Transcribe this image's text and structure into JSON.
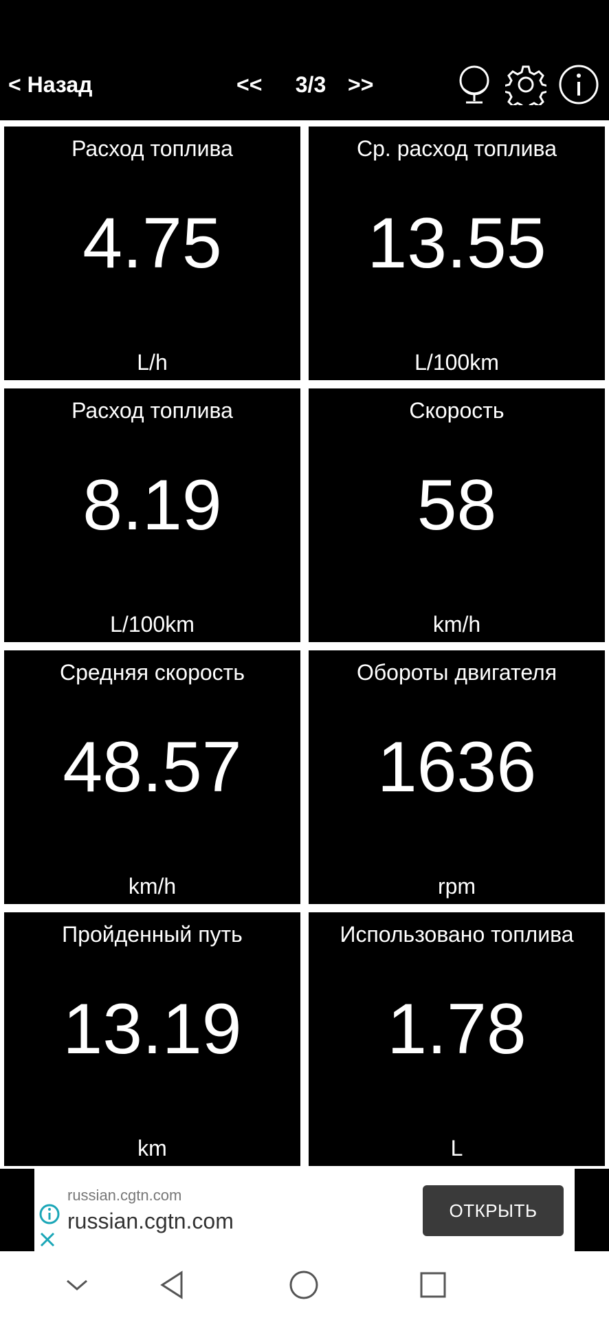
{
  "header": {
    "back_label": "< Назад",
    "prev_label": "<<",
    "page_indicator": "3/3",
    "next_label": ">>"
  },
  "tiles": [
    {
      "title": "Расход топлива",
      "value": "4.75",
      "unit": "L/h"
    },
    {
      "title": "Ср. расход топлива",
      "value": "13.55",
      "unit": "L/100km"
    },
    {
      "title": "Расход топлива",
      "value": "8.19",
      "unit": "L/100km"
    },
    {
      "title": "Скорость",
      "value": "58",
      "unit": "km/h"
    },
    {
      "title": "Средняя скорость",
      "value": "48.57",
      "unit": "km/h"
    },
    {
      "title": "Обороты двигателя",
      "value": "1636",
      "unit": "rpm"
    },
    {
      "title": "Пройденный путь",
      "value": "13.19",
      "unit": "km"
    },
    {
      "title": "Использовано топлива",
      "value": "1.78",
      "unit": "L"
    }
  ],
  "ad": {
    "url_small": "russian.cgtn.com",
    "url_big": "russian.cgtn.com",
    "button_label": "ОТКРЫТЬ",
    "accent_color": "#1aa6b7"
  },
  "icons": {
    "header": [
      "globe-icon",
      "gear-icon",
      "info-icon"
    ],
    "nav": [
      "chevron-down-icon",
      "back-triangle-icon",
      "home-circle-icon",
      "recents-square-icon"
    ]
  }
}
